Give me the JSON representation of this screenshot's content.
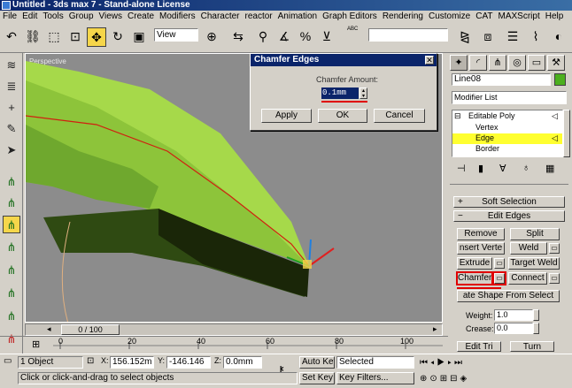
{
  "window": {
    "title": "Untitled - 3ds max 7 - Stand-alone License"
  },
  "menu": [
    "File",
    "Edit",
    "Tools",
    "Group",
    "Views",
    "Create",
    "Modifiers",
    "Character",
    "reactor",
    "Animation",
    "Graph Editors",
    "Rendering",
    "Customize",
    "CAT",
    "MAXScript",
    "Help"
  ],
  "toolbar": {
    "view_dropdown": "View",
    "abc_label": "ABC"
  },
  "viewport": {
    "label": "Perspective"
  },
  "dialog": {
    "title": "Chamfer Edges",
    "amount_label": "Chamfer Amount:",
    "amount_value": "0.1mm",
    "apply": "Apply",
    "ok": "OK",
    "cancel": "Cancel",
    "close_glyph": "✕"
  },
  "command_panel": {
    "object_name": "Line08",
    "object_color": "#4caf1e",
    "modifier_list": "Modifier List",
    "stack": {
      "editable_poly": "Editable Poly",
      "vertex": "Vertex",
      "edge": "Edge",
      "border": "Border"
    },
    "rollouts": {
      "soft_selection": "Soft Selection",
      "edit_edges": "Edit Edges"
    },
    "buttons": {
      "remove": "Remove",
      "split": "Split",
      "insert_vertex": "nsert Verte",
      "weld": "Weld",
      "extrude": "Extrude",
      "target_weld": "Target Weld",
      "chamfer": "Chamfer",
      "connect": "Connect",
      "create_shape": "ate Shape From Select",
      "edit_tri": "Edit Tri",
      "turn": "Turn"
    },
    "weight_label": "Weight:",
    "weight_value": "1.0",
    "crease_label": "Crease:",
    "crease_value": "0.0"
  },
  "timeline": {
    "slider": "0 / 100",
    "ticks": [
      "0",
      "20",
      "40",
      "60",
      "80",
      "100"
    ]
  },
  "status": {
    "selection": "1 Object",
    "x_label": "X:",
    "x_value": "156.152m",
    "y_label": "Y:",
    "y_value": "-146.146",
    "z_label": "Z:",
    "z_value": "0.0mm",
    "prompt": "Click or click-and-drag to select objects",
    "auto_key": "Auto Key",
    "selected": "Selected",
    "set_key": "Set Key",
    "key_filters": "Key Filters..."
  },
  "accent": {
    "highlight": "#f6d64a",
    "mark": "#e00000",
    "object_green": "#8dc43a"
  }
}
